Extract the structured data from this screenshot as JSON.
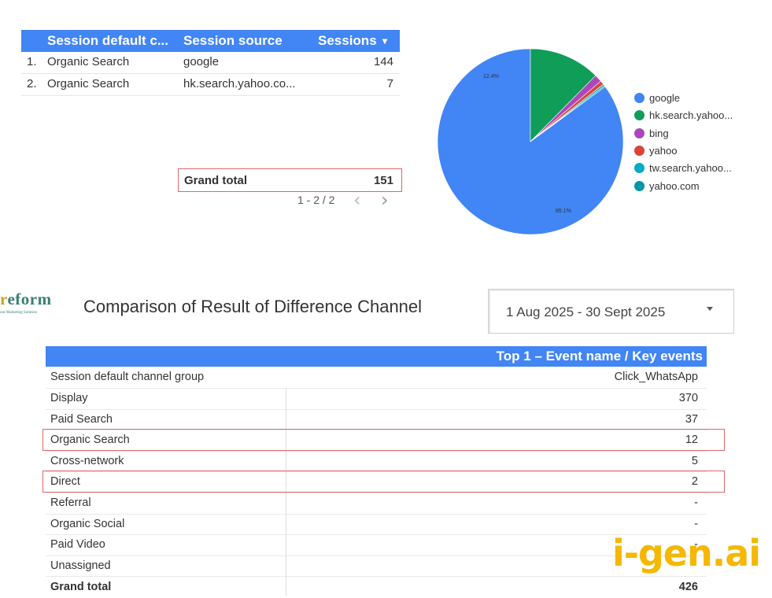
{
  "top_table": {
    "columns": [
      "Session default c...",
      "Session source",
      "Sessions"
    ],
    "sort_indicator": "▾",
    "rows": [
      {
        "index": "1.",
        "channel": "Organic Search",
        "source": "google",
        "sessions": "144"
      },
      {
        "index": "2.",
        "channel": "Organic Search",
        "source": "hk.search.yahoo.co...",
        "sessions": "7"
      }
    ],
    "grand_total_label": "Grand total",
    "grand_total_value": "151",
    "pagination": "1 - 2 / 2",
    "prev_icon": "chevron-left-icon",
    "next_icon": "chevron-right-icon"
  },
  "chart_data": {
    "type": "pie",
    "slices": [
      {
        "label": "google",
        "value": 85.1,
        "color": "#4285f4"
      },
      {
        "label": "hk.search.yahoo...",
        "value": 12.4,
        "color": "#0f9d58"
      },
      {
        "label": "bing",
        "value": 1.3,
        "color": "#ab47bc"
      },
      {
        "label": "yahoo",
        "value": 0.7,
        "color": "#db4437"
      },
      {
        "label": "tw.search.yahoo...",
        "value": 0.3,
        "color": "#00acc1"
      },
      {
        "label": "yahoo.com",
        "value": 0.2,
        "color": "#0097a7"
      }
    ],
    "data_labels": [
      "12.4%",
      "85.1%"
    ],
    "legend_position": "right"
  },
  "logo": {
    "main_r": "r",
    "main_rest": "eform",
    "sub": "our Marketing Solution"
  },
  "section_title": "Comparison of Result of Difference Channel",
  "date_range": {
    "value": "1 Aug 2025 - 30 Sept 2025",
    "icon": "caret-down-icon"
  },
  "bottom_table": {
    "header": "Top 1 – Event name / Key events",
    "column_left": "Session default channel group",
    "column_right": "Click_WhatsApp",
    "rows": [
      {
        "label": "Display",
        "value": "370"
      },
      {
        "label": "Paid Search",
        "value": "37"
      },
      {
        "label": "Organic Search",
        "value": "12"
      },
      {
        "label": "Cross-network",
        "value": "5"
      },
      {
        "label": "Direct",
        "value": "2"
      },
      {
        "label": "Referral",
        "value": "-"
      },
      {
        "label": "Organic Social",
        "value": "-"
      },
      {
        "label": "Paid Video",
        "value": "-"
      },
      {
        "label": "Unassigned",
        "value": ""
      }
    ],
    "grand_total_label": "Grand total",
    "grand_total_value": "426"
  },
  "brand": "i-gen.ai",
  "colors": {
    "accent": "#4285f4",
    "highlight": "#e06666",
    "brand": "#f5b700"
  }
}
